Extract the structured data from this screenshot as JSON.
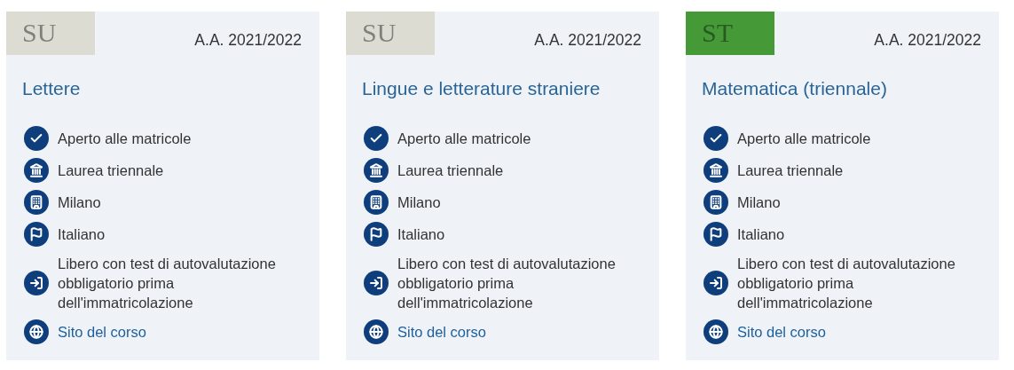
{
  "cards": [
    {
      "badge": {
        "text": "SU",
        "color": "#dcdcd2"
      },
      "year": "A.A. 2021/2022",
      "title": "Lettere",
      "features": [
        {
          "kind": "status",
          "text": "Aperto alle matricole"
        },
        {
          "kind": "degree",
          "text": "Laurea triennale"
        },
        {
          "kind": "location",
          "text": "Milano"
        },
        {
          "kind": "language",
          "text": "Italiano"
        },
        {
          "kind": "access",
          "text": "Libero con test di autovalutazione obbligatorio prima dell'immatricolazione"
        },
        {
          "kind": "link",
          "text": "Sito del corso"
        }
      ]
    },
    {
      "badge": {
        "text": "SU",
        "color": "#dcdcd2"
      },
      "year": "A.A. 2021/2022",
      "title": "Lingue e letterature straniere",
      "features": [
        {
          "kind": "status",
          "text": "Aperto alle matricole"
        },
        {
          "kind": "degree",
          "text": "Laurea triennale"
        },
        {
          "kind": "location",
          "text": "Milano"
        },
        {
          "kind": "language",
          "text": "Italiano"
        },
        {
          "kind": "access",
          "text": "Libero con test di autovalutazione obbligatorio prima dell'immatricolazione"
        },
        {
          "kind": "link",
          "text": "Sito del corso"
        }
      ]
    },
    {
      "badge": {
        "text": "ST",
        "color": "#459a37"
      },
      "year": "A.A. 2021/2022",
      "title": "Matematica (triennale)",
      "features": [
        {
          "kind": "status",
          "text": "Aperto alle matricole"
        },
        {
          "kind": "degree",
          "text": "Laurea triennale"
        },
        {
          "kind": "location",
          "text": "Milano"
        },
        {
          "kind": "language",
          "text": "Italiano"
        },
        {
          "kind": "access",
          "text": "Libero con test di autovalutazione obbligatorio prima dell'immatricolazione"
        },
        {
          "kind": "link",
          "text": "Sito del corso"
        }
      ]
    }
  ]
}
